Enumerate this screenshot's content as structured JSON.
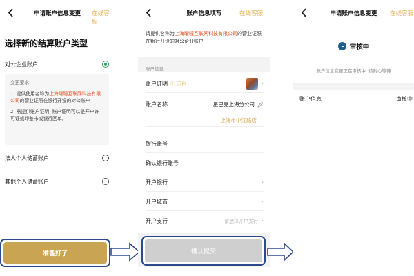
{
  "screen1": {
    "title": "申请账户信息变更",
    "action": "在线客服",
    "heading": "选择新的结算账户类型",
    "options": [
      {
        "label": "对公企业账户",
        "selected": true
      },
      {
        "label": "法人个人储蓄账户",
        "selected": false
      },
      {
        "label": "其他个人储蓄账户",
        "selected": false
      }
    ],
    "requirements": {
      "title": "变更要求:",
      "item1_prefix": "1. 提供使用名称为",
      "item1_company": "上海曜曈互联网科技有限公司",
      "item1_suffix": "的营业证照在银行开设的对公账户",
      "item2": "2. 需提供账户证明, 账户证明可以是开户许可证或印鉴卡或银行回单。"
    },
    "ready_button": "准备好了"
  },
  "screen2": {
    "title": "账户信息填写",
    "action": "在线客服",
    "intro_prefix": "请提供名称为",
    "intro_company": "上海曜曈互联网科技有限公司",
    "intro_suffix": "的营业证照在银行开设的对公企业账户",
    "section_label": "账户信息",
    "rows": {
      "proof": {
        "label": "账户证明",
        "example": "ⓘ 示例"
      },
      "name": {
        "label": "账户名称",
        "value": "星巴克上海分公司",
        "sub": "上海市中江路店"
      },
      "bank_account": {
        "label": "银行账号"
      },
      "confirm_account": {
        "label": "确认银行账号"
      },
      "bank": {
        "label": "开户银行"
      },
      "city": {
        "label": "开户城市"
      },
      "branch": {
        "label": "开户支行",
        "placeholder": "请选择开户支行"
      }
    },
    "submit_button": "确认提交"
  },
  "screen3": {
    "title": "申请账户信息变更",
    "action": "在线客服",
    "status": "审核中",
    "status_sub": "账户信息变更正在审核中, 请耐心等待",
    "info_label": "账户信息",
    "info_value": "审核中"
  },
  "colors": {
    "accent_gold": "#c9a453",
    "highlight_red": "#e4572e",
    "frame_blue": "#2d4a8c",
    "radio_green": "#2fa364"
  }
}
